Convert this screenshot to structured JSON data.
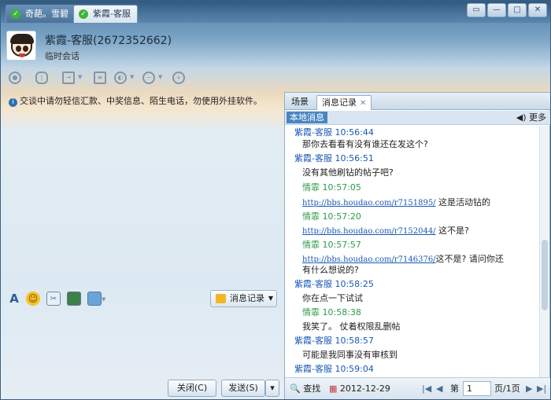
{
  "tabs": [
    {
      "label": "奇葩。雪碧"
    },
    {
      "label": "紫霞-客服"
    }
  ],
  "window_controls": {
    "restore": "▭",
    "minimize": "—",
    "maximize": "□",
    "close": "✕"
  },
  "contact": {
    "name": "紫霞-客服(2672352662)",
    "subtitle": "临时会话",
    "avatar": "cartoon-face"
  },
  "toolbar_icons": [
    "video-icon",
    "mic-icon",
    "transfer-file-icon",
    "document-icon",
    "app-icon",
    "remote-assist-icon",
    "add-contact-icon"
  ],
  "notice": "交谈中请勿轻信汇款、中奖信息、陌生电话，勿使用外挂软件。",
  "format_icons": [
    "font-icon",
    "emoji-icon",
    "screenshot-icon",
    "image-icon",
    "gallery-icon"
  ],
  "history_button": "消息记录",
  "buttons": {
    "close": "关闭(C)",
    "send": "发送(S)",
    "send_arrow": "▾"
  },
  "panel": {
    "tabs": [
      {
        "label": "场景"
      },
      {
        "label": "消息记录"
      }
    ],
    "local_label": "本地消息",
    "more_label": "更多",
    "messages": [
      {
        "type": "header",
        "text": "紫霞-客服   10:56:44",
        "who": "other"
      },
      {
        "type": "body",
        "text": "那你去看看有没有谁还在发这个?"
      },
      {
        "type": "header",
        "text": "紫霞-客服   10:56:51",
        "who": "other"
      },
      {
        "type": "body",
        "text": "没有其他刷钻的帖子吧?"
      },
      {
        "type": "header",
        "text": "情霏   10:57:05",
        "who": "self"
      },
      {
        "type": "link",
        "url": "http://bbs.houdao.com/r7151895/",
        "tail": " 这是活动钻的"
      },
      {
        "type": "header",
        "text": "情霏   10:57:20",
        "who": "self"
      },
      {
        "type": "link",
        "url": "http://bbs.houdao.com/r7152044/",
        "tail": " 这不是?"
      },
      {
        "type": "header",
        "text": "情霏   10:57:57",
        "who": "self"
      },
      {
        "type": "link",
        "url": "http://bbs.houdao.com/r7146376/",
        "tail": "这不是?      请问你还"
      },
      {
        "type": "body",
        "text": "有什么想说的?"
      },
      {
        "type": "header",
        "text": "紫霞-客服   10:58:25",
        "who": "other"
      },
      {
        "type": "body",
        "text": "你在点一下试试"
      },
      {
        "type": "header",
        "text": "情霏   10:58:38",
        "who": "self"
      },
      {
        "type": "body",
        "text": "   我笑了。      仗着权限乱删帖"
      },
      {
        "type": "header",
        "text": "紫霞-客服   10:58:57",
        "who": "other"
      },
      {
        "type": "body",
        "text": "可能是我同事没有审核到"
      },
      {
        "type": "header",
        "text": "紫霞-客服   10:59:04",
        "who": "other"
      }
    ],
    "footer": {
      "find": "查找",
      "date": "2012-12-29",
      "page_prefix": "第",
      "page_value": "1",
      "page_suffix": "页/1页"
    }
  }
}
